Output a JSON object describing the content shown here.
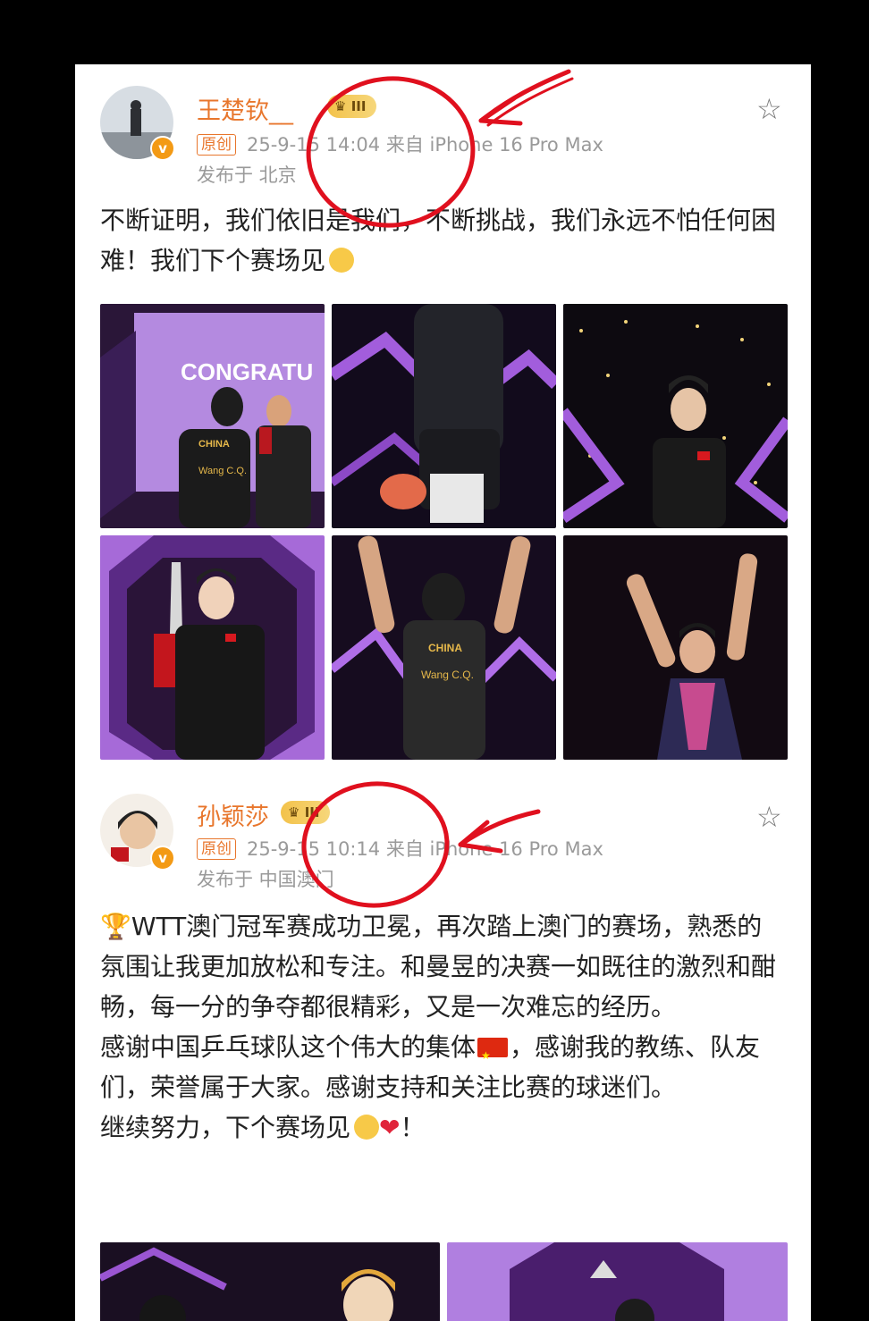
{
  "colors": {
    "accent": "#e8762c",
    "annotation": "#e0101e",
    "gold_badge": "#f3c24a",
    "meta_gray": "#9a9a9a"
  },
  "posts": [
    {
      "username": "王楚钦__",
      "badge_level": "III",
      "original_tag": "原创",
      "datetime_source": "25-9-15 14:04  来自 iPhone 16 Pro Max",
      "location": "发布于 北京",
      "content": "不断证明，我们依旧是我们，不断挑战，我们永远不怕任何困难！我们下个赛场见",
      "content_emoji": "face-emoji",
      "photos": [
        {
          "icon": "photo-congrats-handshake",
          "text": "CONGRATU",
          "jersey": "CHINA",
          "name": "Wang C.Q."
        },
        {
          "icon": "photo-player-back-paddle"
        },
        {
          "icon": "photo-player-podium-tracksuit"
        },
        {
          "icon": "photo-player-holding-trophy"
        },
        {
          "icon": "photo-player-arms-raised",
          "jersey": "CHINA",
          "name": "Wang C.Q."
        },
        {
          "icon": "photo-player-thumbs-up"
        }
      ]
    },
    {
      "username": "孙颖莎",
      "badge_level": "III",
      "original_tag": "原创",
      "datetime_source": "25-9-15 10:14  来自 iPhone 16 Pro Max",
      "location": "发布于 中国澳门",
      "content_lines": [
        "WTT澳门冠军赛成功卫冕，再次踏上澳门的赛场，熟悉的氛围让我更加放松和专注。和曼昱的决赛一如既往的激烈和酣畅，每一分的争夺都很精彩，又是一次难忘的经历。",
        "感谢中国乒乓球队这个伟大的集体",
        "，感谢我的教练、队友们，荣誉属于大家。感谢支持和关注比赛的球迷们。",
        "继续努力，下个赛场见",
        "！"
      ],
      "content_icons": [
        "trophy-icon",
        "china-flag-icon",
        "face-emoji",
        "heart-icon"
      ]
    }
  ]
}
